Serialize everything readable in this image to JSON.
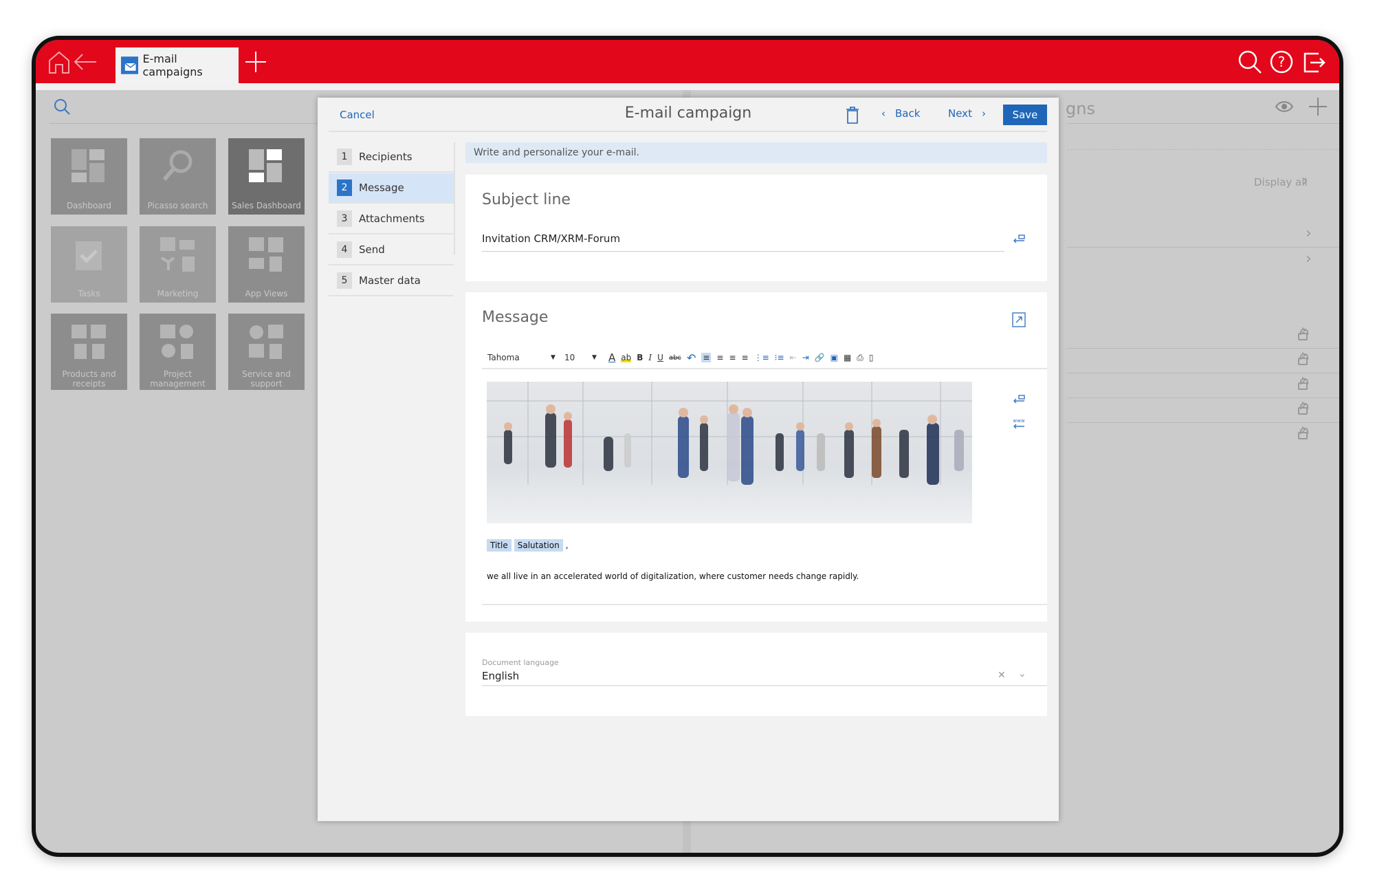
{
  "topbar": {
    "tab_label": "E-mail campaigns",
    "icons": [
      "home-icon",
      "back-arrow-icon",
      "email-campaign-icon",
      "plus-icon",
      "search-icon",
      "help-icon",
      "logout-icon"
    ],
    "accent": "#e2071b"
  },
  "tiles": [
    {
      "label": "Dashboard",
      "icon": "dashboard-icon"
    },
    {
      "label": "Picasso search",
      "icon": "search-icon"
    },
    {
      "label": "Sales Dashboard",
      "icon": "dashboard-icon"
    },
    {
      "label": "Tasks",
      "icon": "clipboard-check-icon"
    },
    {
      "label": "Marketing",
      "icon": "marketing-icon"
    },
    {
      "label": "App Views",
      "icon": "app-views-icon"
    },
    {
      "label": "Products and receipts",
      "icon": "products-icon"
    },
    {
      "label": "Project management",
      "icon": "project-icon"
    },
    {
      "label": "Service and support",
      "icon": "service-icon"
    }
  ],
  "right_panel": {
    "title_fragment": "gns",
    "display_all": "Display all"
  },
  "dialog": {
    "cancel": "Cancel",
    "title": "E-mail campaign",
    "back": "Back",
    "next": "Next",
    "save": "Save",
    "primary": "#1f66b8",
    "steps": [
      {
        "num": "1",
        "label": "Recipients"
      },
      {
        "num": "2",
        "label": "Message",
        "active": true
      },
      {
        "num": "3",
        "label": "Attachments"
      },
      {
        "num": "4",
        "label": "Send"
      },
      {
        "num": "5",
        "label": "Master data"
      }
    ],
    "info": "Write and personalize your e-mail.",
    "subject": {
      "heading": "Subject line",
      "value": "Invitation CRM/XRM-Forum"
    },
    "message": {
      "heading": "Message",
      "font": "Tahoma",
      "size": "10",
      "tag_title": "Title",
      "tag_salutation": "Salutation",
      "comma": ",",
      "body": "we all live in an accelerated world of digitalization, where customer needs change rapidly."
    },
    "language": {
      "label": "Document language",
      "value": "English"
    }
  }
}
